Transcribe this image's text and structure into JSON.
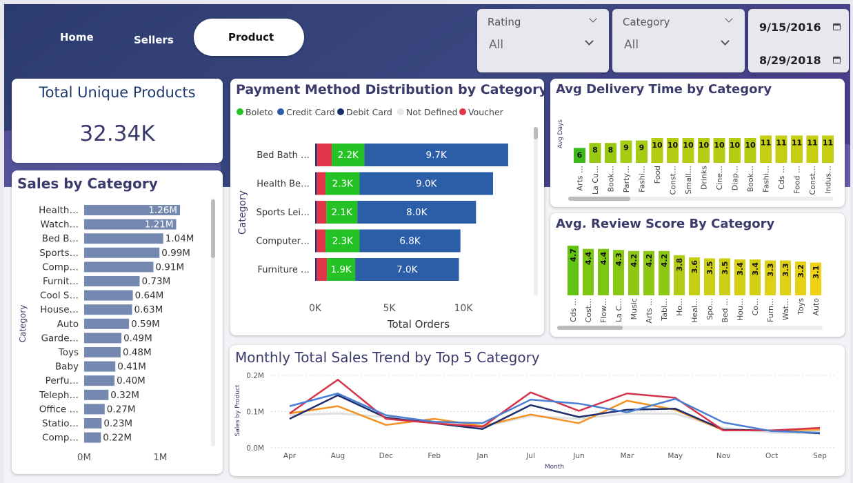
{
  "nav": {
    "home": "Home",
    "sellers": "Sellers",
    "product": "Product"
  },
  "filters": {
    "rating": {
      "label": "Rating",
      "value": "All"
    },
    "category": {
      "label": "Category",
      "value": "All"
    },
    "date_start": "9/15/2016",
    "date_end": "8/29/2018"
  },
  "kpi": {
    "title": "Total Unique Products",
    "value": "32.34K"
  },
  "colors": {
    "accent": "#3b3b6b",
    "bar": "#7589b0",
    "boleto": "#24c224",
    "credit": "#2c5ea8",
    "debit": "#1b2f6e",
    "voucher": "#e0364a",
    "line_red": "#d4344a",
    "line_blue": "#4a7fd4",
    "line_navy": "#1e2e6e",
    "line_orange": "#f39222",
    "line_grey": "#e0e0e0"
  },
  "chart_data": [
    {
      "type": "bar",
      "title": "Sales by Category",
      "ylabel": "Category",
      "categories": [
        "Health…",
        "Watch…",
        "Bed B…",
        "Sports…",
        "Comp…",
        "Furnit…",
        "Cool S…",
        "House…",
        "Auto",
        "Garde…",
        "Toys",
        "Baby",
        "Perfu…",
        "Teleph…",
        "Office …",
        "Statio…",
        "Comp…"
      ],
      "values": [
        1.26,
        1.21,
        1.04,
        0.99,
        0.91,
        0.73,
        0.64,
        0.63,
        0.59,
        0.49,
        0.48,
        0.41,
        0.4,
        0.32,
        0.27,
        0.23,
        0.22
      ],
      "labels": [
        "1.26M",
        "1.21M",
        "1.04M",
        "0.99M",
        "0.91M",
        "0.73M",
        "0.64M",
        "0.63M",
        "0.59M",
        "0.49M",
        "0.48M",
        "0.41M",
        "0.40M",
        "0.32M",
        "0.27M",
        "0.23M",
        "0.22M"
      ],
      "xticks": [
        "0M",
        "1M"
      ],
      "xlim": [
        0,
        1.45
      ]
    },
    {
      "type": "bar",
      "title": "Payment Method Distribution by Category",
      "xlabel": "Total Orders",
      "ylabel": "Category",
      "legend": [
        "Boleto",
        "Credit Card",
        "Debit Card",
        "Not Defined",
        "Voucher"
      ],
      "categories": [
        "Bed Bath …",
        "Health Be…",
        "Sports Lei…",
        "Computer…",
        "Furniture …"
      ],
      "series": [
        {
          "name": "Debit Card",
          "values": [
            120,
            100,
            100,
            100,
            100
          ]
        },
        {
          "name": "Voucher",
          "values": [
            1000,
            600,
            650,
            600,
            700
          ]
        },
        {
          "name": "Boleto",
          "values": [
            2200,
            2300,
            2100,
            2300,
            1900
          ]
        },
        {
          "name": "Credit Card",
          "values": [
            9700,
            9000,
            8000,
            6800,
            7000
          ]
        }
      ],
      "boleto_labels": [
        "2.2K",
        "2.3K",
        "2.1K",
        "2.3K",
        "1.9K"
      ],
      "credit_labels": [
        "9.7K",
        "9.0K",
        "8.0K",
        "6.8K",
        "7.0K"
      ],
      "xticks": [
        "0K",
        "5K",
        "10K"
      ],
      "xlim": [
        0,
        14000
      ]
    },
    {
      "type": "bar",
      "title": "Avg Delivery Time by Category",
      "ylabel": "Avg Days",
      "categories": [
        "Arts …",
        "La Cu…",
        "Book…",
        "Party…",
        "Fashi…",
        "Food",
        "Const…",
        "Small…",
        "Drinks",
        "Cine…",
        "Diap…",
        "Book…",
        "Fashi…",
        "Cds …",
        "Food …",
        "Const…",
        "Indus…"
      ],
      "values": [
        6,
        8,
        8,
        9,
        9,
        10,
        10,
        10,
        10,
        10,
        10,
        10,
        11,
        11,
        11,
        11,
        11
      ],
      "ylim": [
        0,
        14
      ]
    },
    {
      "type": "bar",
      "title": "Avg. Review Score By Category",
      "categories": [
        "Cds …",
        "Cost…",
        "Flow…",
        "La C…",
        "Music",
        "Arts …",
        "Tabl…",
        "Ho…",
        "Heal…",
        "Spo…",
        "Bed …",
        "Hou…",
        "Co…",
        "Furn…",
        "Wat…",
        "Toys",
        "Auto"
      ],
      "values": [
        4.7,
        4.4,
        4.4,
        4.3,
        4.2,
        4.2,
        4.2,
        3.8,
        3.6,
        3.5,
        3.5,
        3.4,
        3.4,
        3.3,
        3.3,
        3.2,
        3.1
      ],
      "ylim": [
        0,
        5
      ]
    },
    {
      "type": "line",
      "title": "Monthly Total Sales Trend by Top 5 Category",
      "xlabel": "Month",
      "ylabel": "Sales by Product",
      "x": [
        "Apr",
        "Aug",
        "Dec",
        "Feb",
        "Jan",
        "Jul",
        "Jun",
        "Mar",
        "May",
        "Nov",
        "Oct",
        "Sep"
      ],
      "yticks": [
        "0.0M",
        "0.1M",
        "0.2M"
      ],
      "ylim": [
        0,
        0.2
      ],
      "series": [
        {
          "color": "#e0e0e0",
          "values": [
            0.09,
            0.095,
            0.085,
            0.072,
            0.058,
            0.088,
            0.08,
            0.095,
            0.094,
            0.055,
            0.042,
            0.04
          ]
        },
        {
          "color": "#f39222",
          "values": [
            0.095,
            0.115,
            0.063,
            0.08,
            0.06,
            0.092,
            0.068,
            0.13,
            0.105,
            0.048,
            0.048,
            0.05
          ]
        },
        {
          "color": "#1e2e6e",
          "values": [
            0.08,
            0.145,
            0.083,
            0.068,
            0.052,
            0.118,
            0.085,
            0.105,
            0.108,
            0.05,
            0.048,
            0.04
          ]
        },
        {
          "color": "#d4344a",
          "values": [
            0.095,
            0.188,
            0.08,
            0.068,
            0.058,
            0.153,
            0.102,
            0.15,
            0.138,
            0.048,
            0.048,
            0.055
          ]
        },
        {
          "color": "#4a7fd4",
          "values": [
            0.115,
            0.15,
            0.09,
            0.072,
            0.068,
            0.133,
            0.122,
            0.098,
            0.135,
            0.07,
            0.046,
            0.042
          ]
        }
      ]
    }
  ]
}
